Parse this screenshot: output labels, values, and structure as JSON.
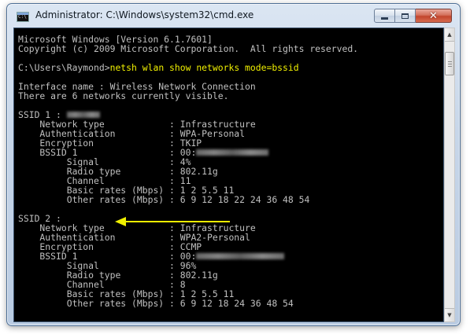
{
  "window": {
    "title": "Administrator: C:\\Windows\\system32\\cmd.exe",
    "icon": "cmd-icon",
    "icon_text": "C:\\"
  },
  "controls": {
    "minimize_icon": "minimize-icon",
    "maximize_icon": "maximize-icon",
    "close_glyph": "✕"
  },
  "colors": {
    "console_bg": "#000000",
    "console_text": "#c0c0c0",
    "command_text": "#f0f000",
    "arrow": "#f0f000"
  },
  "console": {
    "header": [
      "Microsoft Windows [Version 6.1.7601]",
      "Copyright (c) 2009 Microsoft Corporation.  All rights reserved."
    ],
    "prompt": "C:\\Users\\Raymond>",
    "command": "netsh wlan show networks mode=bssid",
    "interface": [
      "Interface name : Wireless Network Connection",
      "There are 6 networks currently visible."
    ],
    "network1": {
      "ssid_label": "SSID 1 : ",
      "rows": [
        {
          "label": "    Network type            : ",
          "value": "Infrastructure"
        },
        {
          "label": "    Authentication          : ",
          "value": "WPA-Personal"
        },
        {
          "label": "    Encryption              : ",
          "value": "TKIP"
        },
        {
          "label": "    BSSID 1                 : ",
          "value": "00:"
        },
        {
          "label": "         Signal             : ",
          "value": "4%"
        },
        {
          "label": "         Radio type         : ",
          "value": "802.11g"
        },
        {
          "label": "         Channel            : ",
          "value": "11"
        },
        {
          "label": "         Basic rates (Mbps) : ",
          "value": "1 2 5.5 11"
        },
        {
          "label": "         Other rates (Mbps) : ",
          "value": "6 9 12 18 22 24 36 48 54"
        }
      ]
    },
    "network2": {
      "ssid_label": "SSID 2 : ",
      "rows": [
        {
          "label": "    Network type            : ",
          "value": "Infrastructure"
        },
        {
          "label": "    Authentication          : ",
          "value": "WPA2-Personal"
        },
        {
          "label": "    Encryption              : ",
          "value": "CCMP"
        },
        {
          "label": "    BSSID 1                 : ",
          "value": "00:"
        },
        {
          "label": "         Signal             : ",
          "value": "96%"
        },
        {
          "label": "         Radio type         : ",
          "value": "802.11g"
        },
        {
          "label": "         Channel            : ",
          "value": "8"
        },
        {
          "label": "         Basic rates (Mbps) : ",
          "value": "1 2 5.5 11"
        },
        {
          "label": "         Other rates (Mbps) : ",
          "value": "6 9 12 18 24 36 48 54"
        }
      ]
    }
  }
}
